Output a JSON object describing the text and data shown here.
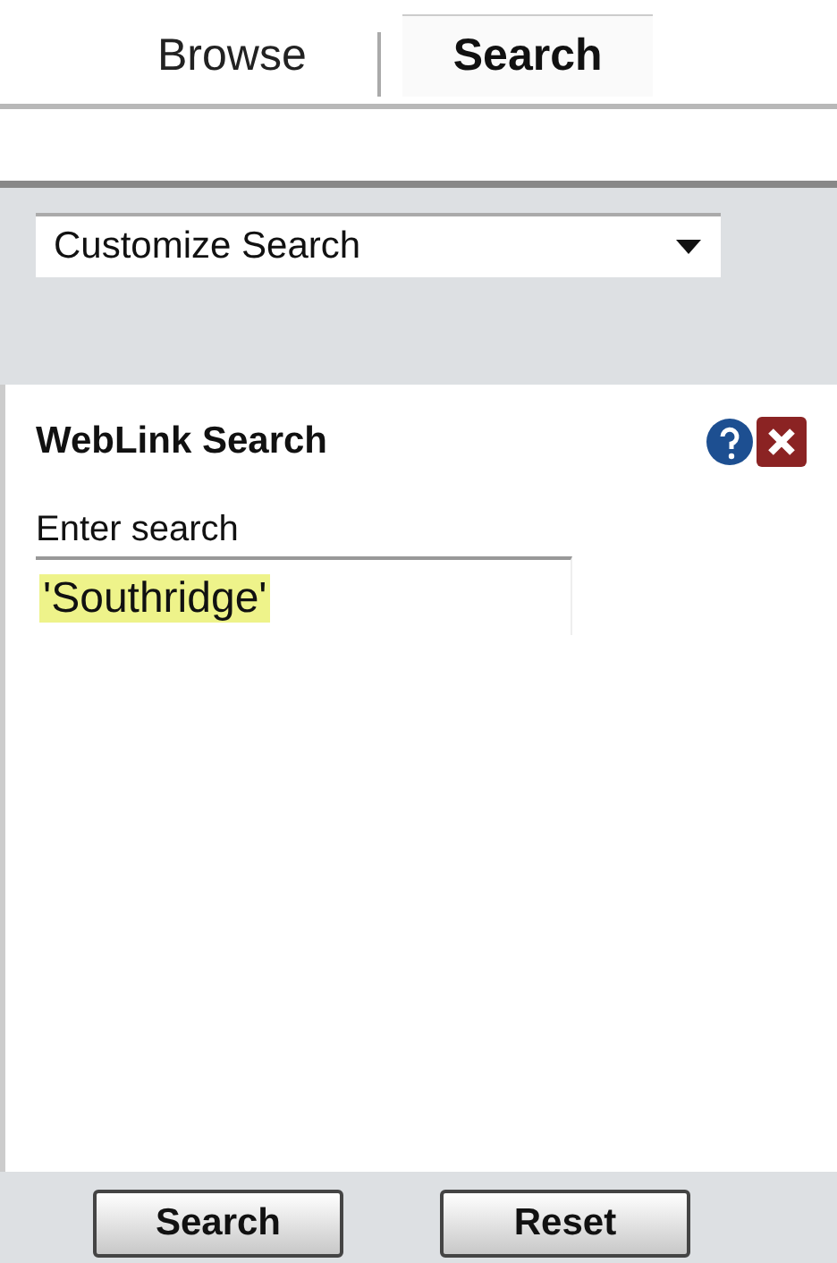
{
  "tabs": [
    {
      "label": "Browse",
      "selected": false
    },
    {
      "label": "Search",
      "selected": true
    }
  ],
  "dropdown": {
    "value": "Customize Search"
  },
  "panel": {
    "title": "WebLink Search",
    "field_label": "Enter search",
    "field_value": "'Southridge'",
    "value_highlighted": true
  },
  "buttons": [
    "Search",
    "Reset"
  ]
}
